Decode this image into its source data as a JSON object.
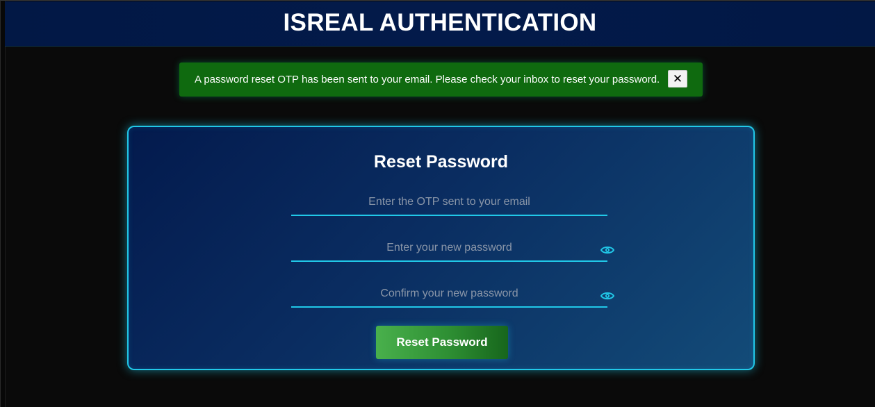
{
  "header": {
    "title": "ISREAL AUTHENTICATION"
  },
  "alert": {
    "message": "A password reset OTP has been sent to your email. Please check your inbox to reset your password.",
    "close_label": "✕"
  },
  "form": {
    "title": "Reset Password",
    "otp_placeholder": "Enter the OTP sent to your email",
    "otp_value": "",
    "new_password_placeholder": "Enter your new password",
    "new_password_value": "",
    "confirm_password_placeholder": "Confirm your new password",
    "confirm_password_value": "",
    "submit_label": "Reset Password",
    "toggle_icon": "eye-icon"
  },
  "colors": {
    "header_bg": "#021845",
    "alert_bg": "#0f6a0f",
    "card_border": "#21c8e8",
    "accent": "#21c8e8",
    "button_start": "#49b04c",
    "button_end": "#17661c",
    "page_bg": "#0a0a0a"
  }
}
